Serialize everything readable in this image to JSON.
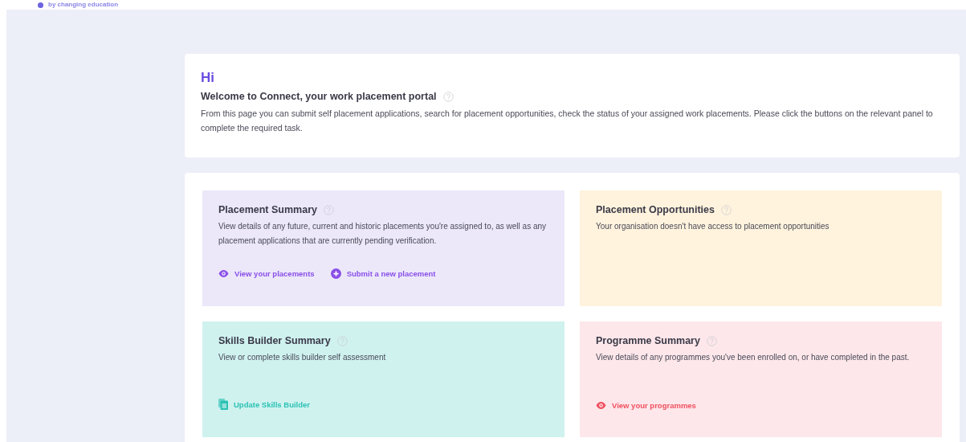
{
  "header": {
    "tagline": "by changing education"
  },
  "welcome": {
    "greeting": "Hi",
    "title": "Welcome to Connect, your work placement portal",
    "description": "From this page you can submit self placement applications, search for placement opportunities, check the status of your assigned work placements. Please click the buttons on the relevant panel to complete the required task."
  },
  "panels": [
    {
      "title": "Placement Summary",
      "description": "View details of any future, current and historic placements you're assigned to, as well as any placement applications that are currently pending verification.",
      "color": "#ece8fa",
      "actions": [
        {
          "label": "View your placements",
          "kind": "eye",
          "color": "#8a4fe8"
        },
        {
          "label": "Submit a new placement",
          "kind": "plus",
          "color": "#8a4fe8"
        }
      ]
    },
    {
      "title": "Placement Opportunities",
      "description": "Your organisation doesn't have access to placement opportunities",
      "color": "#fff3dd"
    },
    {
      "title": "Skills Builder Summary",
      "description": "View or complete skills builder self assessment",
      "color": "#cff2ef",
      "actions": [
        {
          "label": "Update Skills Builder",
          "kind": "document",
          "color": "#2cc2b4"
        }
      ]
    },
    {
      "title": "Programme Summary",
      "description": "View details of any programmes you've been enrolled on, or have completed in the past.",
      "color": "#fde7ea",
      "actions": [
        {
          "label": "View your programmes",
          "kind": "eye",
          "color": "#f0505f"
        }
      ]
    }
  ]
}
